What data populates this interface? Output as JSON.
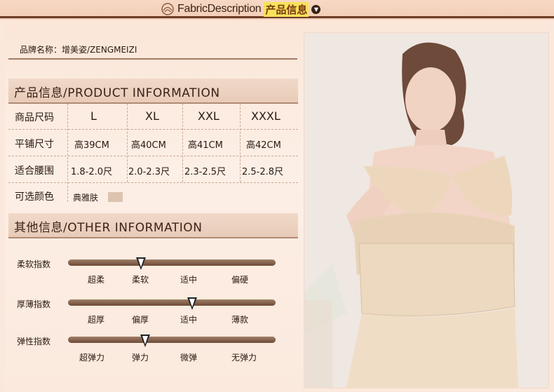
{
  "header": {
    "title_en": "FabricDescription",
    "title_cn": "产品信息"
  },
  "brand": {
    "label": "品牌名称：增美姿/ZENGMEIZI"
  },
  "product_section": {
    "heading": "产品信息/PRODUCT INFORMATION",
    "rows": [
      {
        "label": "商品尺码",
        "values": [
          "L",
          "XL",
          "XXL",
          "XXXL"
        ]
      },
      {
        "label": "平铺尺寸",
        "values": [
          "高39CM",
          "高40CM",
          "高41CM",
          "高42CM"
        ]
      },
      {
        "label": "适合腰围",
        "values": [
          "1.8-2.0尺",
          "2.0-2.3尺",
          "2.3-2.5尺",
          "2.5-2.8尺"
        ]
      }
    ],
    "color_label": "可选颜色",
    "color_value": "典雅肤",
    "color_swatch": "#dcc3b0"
  },
  "other_section": {
    "heading": "其他信息/OTHER INFORMATION",
    "sliders": [
      {
        "label": "柔软指数",
        "ticks": [
          "超柔",
          "柔软",
          "适中",
          "偏硬"
        ],
        "selected": 1
      },
      {
        "label": "厚薄指数",
        "ticks": [
          "超厚",
          "偏厚",
          "适中",
          "薄款"
        ],
        "selected": 2
      },
      {
        "label": "弹性指数",
        "ticks": [
          "超弹力",
          "弹力",
          "微弹",
          "无弹力"
        ],
        "selected": 1
      }
    ]
  },
  "colors": {
    "accent": "#6b3c26",
    "background": "#fbe8dc",
    "highlight": "#f7e25a"
  }
}
